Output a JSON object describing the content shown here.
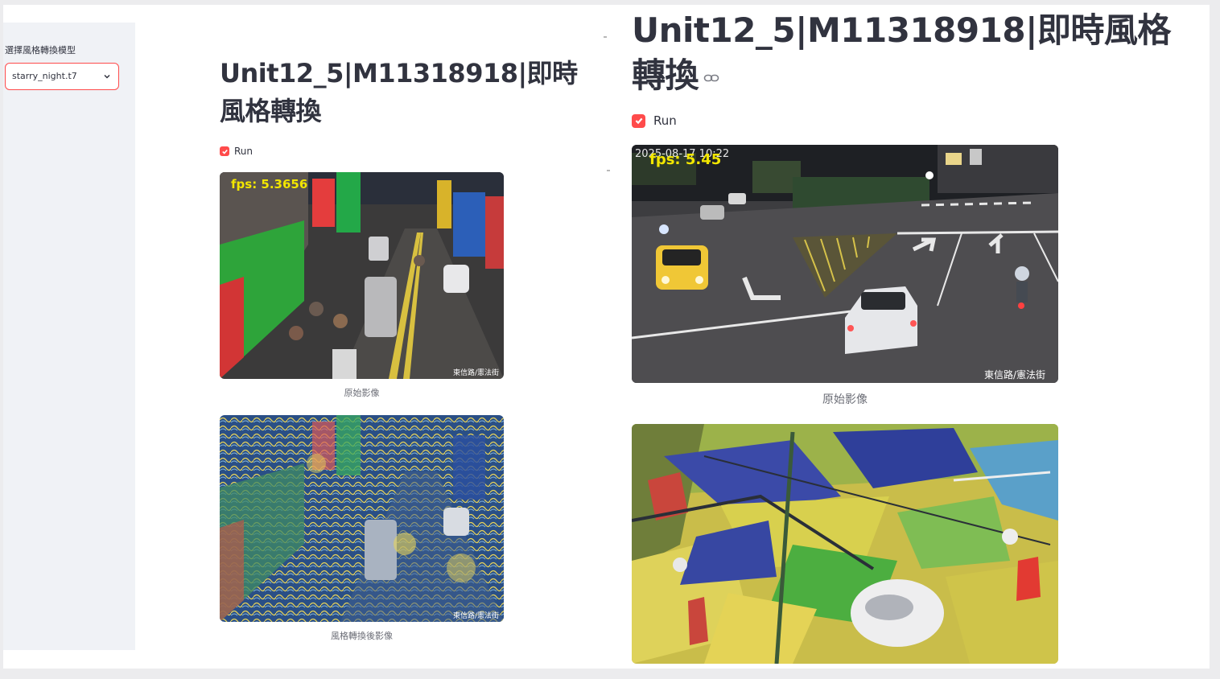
{
  "left_app": {
    "sidebar": {
      "label": "選擇風格轉換模型",
      "select_value": "starry_night.t7"
    },
    "title": "Unit12_5|M11318918|即時風格轉換",
    "run_checkbox": {
      "label": "Run",
      "checked": true
    },
    "original_frame": {
      "fps_overlay": "fps: 5.3656",
      "camera_label": "東信路/憲法街",
      "caption": "原始影像"
    },
    "styled_frame": {
      "camera_label": "東信路/憲法街",
      "caption": "風格轉換後影像"
    }
  },
  "right_app": {
    "title": "Unit12_5|M11318918|即時風格轉換",
    "run_checkbox": {
      "label": "Run",
      "checked": true
    },
    "original_frame": {
      "fps_overlay": "fps: 5.45",
      "timestamp": "2025-08-17 10:22",
      "camera_label": "東信路/憲法街",
      "caption": "原始影像"
    }
  },
  "colors": {
    "accent": "#ff4b4b",
    "text": "#31333f",
    "caption": "#6b6d76",
    "sidebar_bg": "#f0f2f6",
    "fps_overlay": "#f2e600"
  },
  "icons": [
    "chevron-down-icon",
    "link-icon",
    "check-icon"
  ]
}
